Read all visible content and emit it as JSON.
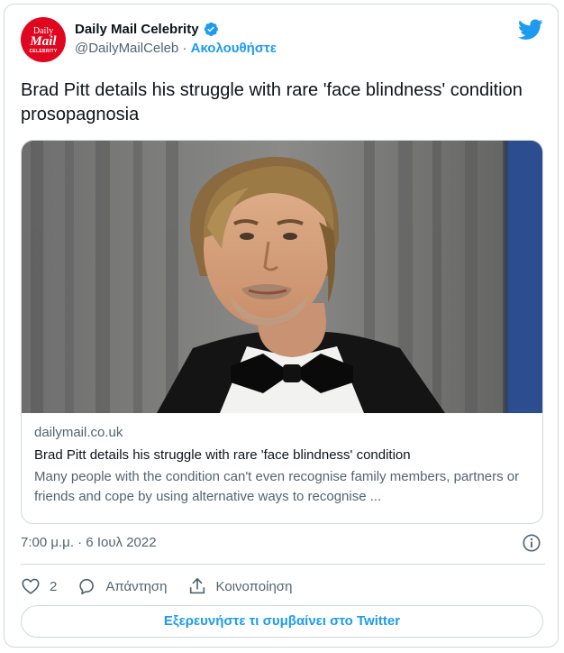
{
  "author": {
    "name": "Daily Mail Celebrity",
    "handle": "@DailyMailCeleb",
    "separator": "·",
    "follow_label": "Ακολουθήστε",
    "avatar_line1": "Daily",
    "avatar_line2": "Mail",
    "avatar_line3": "CELEBRITY"
  },
  "tweet": {
    "text": "Brad Pitt details his struggle with rare 'face blindness' condition prosopagnosia"
  },
  "link_card": {
    "domain": "dailymail.co.uk",
    "title": "Brad Pitt details his struggle with rare 'face blindness' condition",
    "description": "Many people with the condition can't even recognise family members, partners or friends and cope by using alternative ways to recognise ..."
  },
  "timestamp": "7:00 μ.μ. · 6 Ιουλ 2022",
  "actions": {
    "like_count": "2",
    "reply_label": "Απάντηση",
    "share_label": "Κοινοποίηση"
  },
  "explore_label": "Εξερευνήστε τι συμβαίνει στο Twitter",
  "colors": {
    "accent": "#1d9bf0",
    "brand_red": "#e1061f",
    "secondary_text": "#536471",
    "border": "#cfd9de"
  },
  "icons": [
    "verified-icon",
    "twitter-logo-icon",
    "info-icon",
    "heart-icon",
    "reply-icon",
    "share-icon"
  ]
}
